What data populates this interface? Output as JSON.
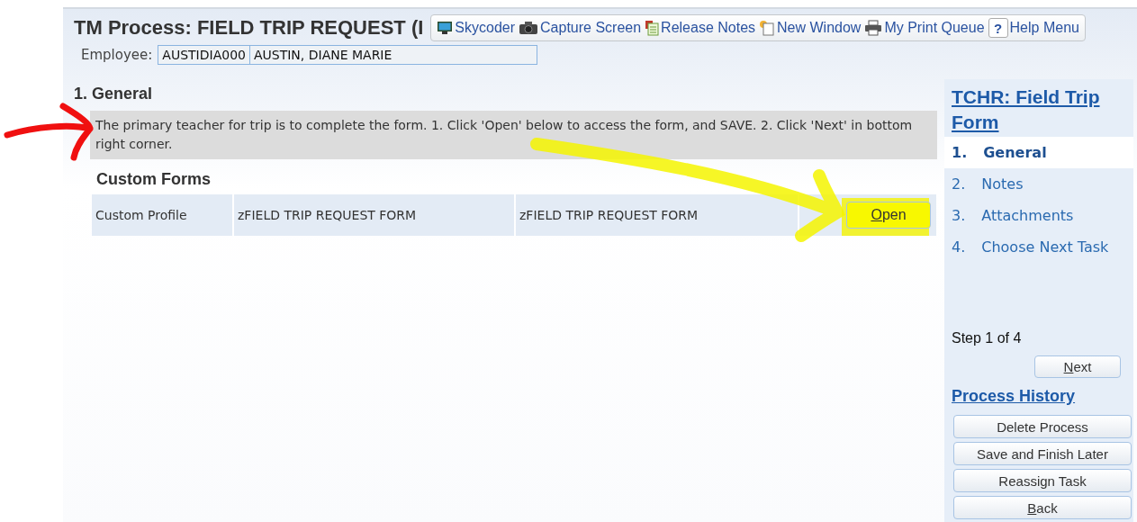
{
  "header": {
    "title": "TM Process: FIELD TRIP REQUEST (I",
    "toolbar": [
      {
        "label": "Skycoder",
        "kind": "monitor"
      },
      {
        "label": "Capture Screen",
        "kind": "camera"
      },
      {
        "label": "Release Notes",
        "kind": "notes"
      },
      {
        "label": "New Window",
        "kind": "window"
      },
      {
        "label": "My Print Queue",
        "kind": "printer"
      },
      {
        "label": "Help Menu",
        "kind": "help",
        "icon_text": "?"
      }
    ]
  },
  "employee": {
    "label": "Employee:",
    "id": "AUSTIDIA000",
    "name": "AUSTIN, DIANE MARIE"
  },
  "section": {
    "title": "1. General",
    "instructions": "The primary teacher for trip is to complete the form. 1. Click 'Open' below to access the form, and SAVE. 2. Click 'Next' in bottom right corner."
  },
  "custom_forms": {
    "title": "Custom Forms",
    "rows": [
      {
        "cells": [
          "Custom Profile",
          "zFIELD TRIP REQUEST FORM",
          "zFIELD TRIP REQUEST FORM"
        ],
        "button": {
          "label": "Open",
          "mnemonic": true
        }
      }
    ]
  },
  "sidebar": {
    "title": "TCHR: Field Trip Form",
    "steps": [
      {
        "number": "1.",
        "label": "General",
        "selected": true
      },
      {
        "number": "2.",
        "label": "Notes",
        "selected": false
      },
      {
        "number": "3.",
        "label": "Attachments",
        "selected": false
      },
      {
        "number": "4.",
        "label": "Choose Next Task",
        "selected": false
      }
    ],
    "step_text": "Step 1 of 4",
    "next_button": {
      "label": "Next",
      "mnemonic": true
    },
    "history_link": "Process History",
    "buttons": [
      {
        "label": "Delete Process",
        "mnemonic": false
      },
      {
        "label": "Save and Finish Later",
        "mnemonic": false
      },
      {
        "label": "Reassign Task",
        "mnemonic": false
      },
      {
        "label": "Back",
        "mnemonic": true
      }
    ]
  }
}
